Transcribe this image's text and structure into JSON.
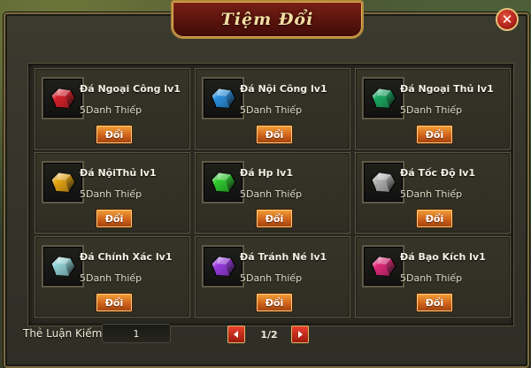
{
  "window": {
    "title": "Tiệm Đổi",
    "close_label": "✕"
  },
  "items": [
    {
      "name": "Đá Ngoại Công lv1",
      "price": "5Danh Thiếp",
      "button": "Đổi",
      "icon": "red-gem-icon",
      "color": "#d8202a"
    },
    {
      "name": "Đá Nội Công lv1",
      "price": "5Danh Thiếp",
      "button": "Đổi",
      "icon": "blue-gem-icon",
      "color": "#2a90e0"
    },
    {
      "name": "Đá Ngoại Thủ lv1",
      "price": "5Danh Thiếp",
      "button": "Đổi",
      "icon": "green-gem-icon",
      "color": "#19a860"
    },
    {
      "name": "Đá NộiThủ lv1",
      "price": "5Danh Thiếp",
      "button": "Đổi",
      "icon": "yellow-gem-icon",
      "color": "#e7a512"
    },
    {
      "name": "Đá Hp lv1",
      "price": "5Danh Thiếp",
      "button": "Đổi",
      "icon": "lime-gem-icon",
      "color": "#2ecc2e"
    },
    {
      "name": "Đá Tốc Độ lv1",
      "price": "5Danh Thiếp",
      "button": "Đổi",
      "icon": "gray-gem-icon",
      "color": "#b0b0b0"
    },
    {
      "name": "Đá Chính Xác lv1",
      "price": "5Danh Thiếp",
      "button": "Đổi",
      "icon": "cyan-gem-icon",
      "color": "#8fd0d4"
    },
    {
      "name": "Đá Tránh Né lv1",
      "price": "5Danh Thiếp",
      "button": "Đổi",
      "icon": "purple-gem-icon",
      "color": "#9a3ae0"
    },
    {
      "name": "Đá Bạo Kích lv1",
      "price": "5Danh Thiếp",
      "button": "Đổi",
      "icon": "pink-gem-icon",
      "color": "#e02a7a"
    }
  ],
  "footer": {
    "card_label": "Thẻ Luận Kiếm",
    "card_value": "1",
    "page": "1/2",
    "prev_icon": "left-arrow-icon",
    "next_icon": "right-arrow-icon"
  }
}
